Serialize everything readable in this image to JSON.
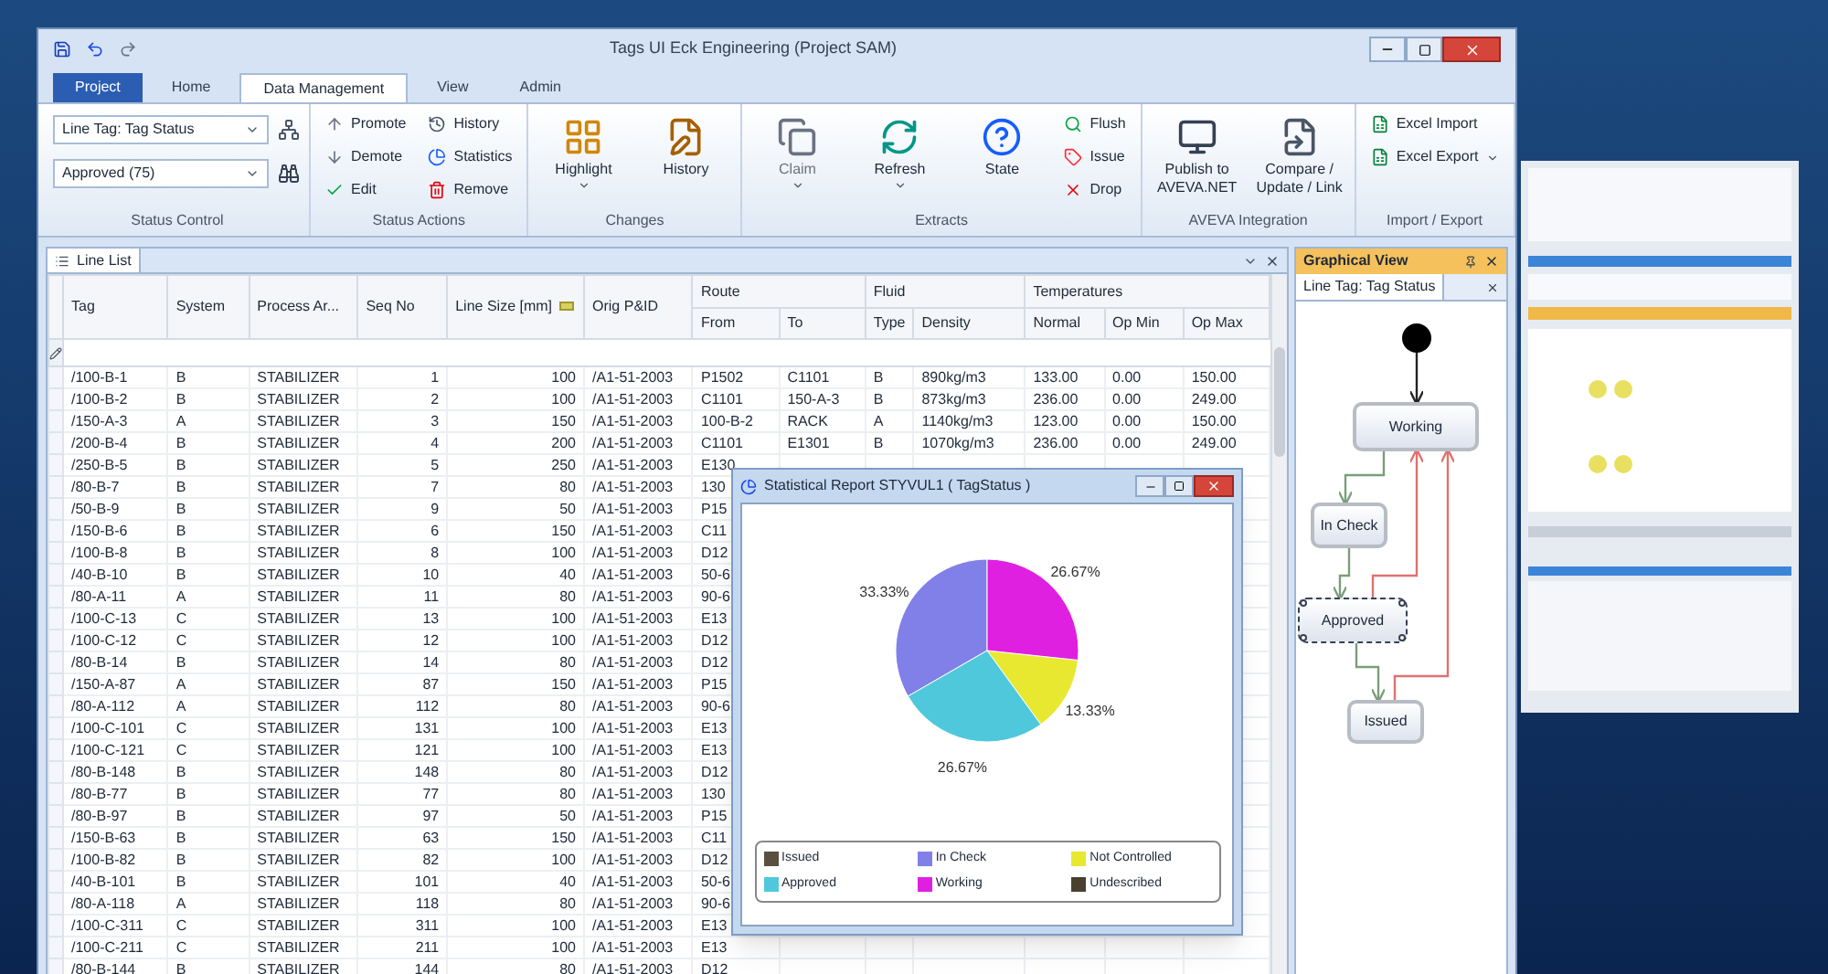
{
  "window": {
    "title": "Tags UI Eck Engineering (Project SAM)"
  },
  "ribbon_tabs": [
    {
      "label": "Project",
      "kind": "app",
      "selected": false
    },
    {
      "label": "Home",
      "kind": "tab",
      "selected": false
    },
    {
      "label": "Data Management",
      "kind": "tab",
      "selected": true
    },
    {
      "label": "View",
      "kind": "tab",
      "selected": false
    },
    {
      "label": "Admin",
      "kind": "tab",
      "selected": false
    }
  ],
  "ribbon_groups": [
    {
      "label": "Status Control",
      "items": [
        {
          "kind": "dropdown",
          "value": "Line Tag: Tag Status"
        },
        {
          "kind": "dropdown",
          "value": "Approved (75)"
        }
      ]
    },
    {
      "label": "Status Actions",
      "items": [
        {
          "kind": "small",
          "label": "Promote",
          "disabled": false,
          "menu": false
        },
        {
          "kind": "small",
          "label": "Demote",
          "disabled": false,
          "menu": false
        },
        {
          "kind": "small",
          "label": "Edit",
          "disabled": false,
          "menu": false
        },
        {
          "kind": "small",
          "label": "History",
          "disabled": false,
          "menu": false
        },
        {
          "kind": "small",
          "label": "Statistics",
          "disabled": false,
          "menu": false
        },
        {
          "kind": "small",
          "label": "Remove",
          "disabled": false,
          "menu": false
        }
      ]
    },
    {
      "label": "Changes",
      "items": [
        {
          "kind": "large",
          "label": "Highlight",
          "disabled": false,
          "menu": true
        },
        {
          "kind": "large",
          "label": "History",
          "disabled": false,
          "menu": false
        }
      ]
    },
    {
      "label": "Extracts",
      "items": [
        {
          "kind": "large",
          "label": "Claim",
          "disabled": true,
          "menu": true
        },
        {
          "kind": "large",
          "label": "Refresh",
          "disabled": false,
          "menu": true
        },
        {
          "kind": "large",
          "label": "State",
          "disabled": false,
          "menu": false
        },
        {
          "kind": "small",
          "label": "Flush",
          "disabled": false,
          "menu": false
        },
        {
          "kind": "small",
          "label": "Issue",
          "disabled": false,
          "menu": false
        },
        {
          "kind": "small",
          "label": "Drop",
          "disabled": false,
          "menu": false
        }
      ]
    },
    {
      "label": "AVEVA Integration",
      "items": [
        {
          "kind": "large",
          "label": "Publish to AVEVA.NET",
          "disabled": false,
          "menu": false
        },
        {
          "kind": "large",
          "label": "Compare / Update / Link",
          "disabled": false,
          "menu": false
        }
      ]
    },
    {
      "label": "Import / Export",
      "items": [
        {
          "kind": "small",
          "label": "Excel Import",
          "disabled": false,
          "menu": false
        },
        {
          "kind": "small",
          "label": "Excel Export",
          "disabled": false,
          "menu": true
        }
      ]
    }
  ],
  "line_list": {
    "title": "Line List",
    "column_groups": [
      {
        "label": "Route"
      },
      {
        "label": "Fluid"
      },
      {
        "label": "Temperatures"
      }
    ],
    "columns": [
      {
        "label": "Tag"
      },
      {
        "label": "System"
      },
      {
        "label": "Process Ar..."
      },
      {
        "label": "Seq No"
      },
      {
        "label": "Line Size [mm]"
      },
      {
        "label": "Orig P&ID"
      },
      {
        "label": "From"
      },
      {
        "label": "To"
      },
      {
        "label": "Type"
      },
      {
        "label": "Density"
      },
      {
        "label": "Normal"
      },
      {
        "label": "Op Min"
      },
      {
        "label": "Op Max"
      }
    ],
    "rows": [
      [
        "/100-B-1",
        "B",
        "STABILIZER",
        "1",
        "100",
        "/A1-51-2003",
        "P1502",
        "C1101",
        "B",
        "890kg/m3",
        "133.00",
        "0.00",
        "150.00"
      ],
      [
        "/100-B-2",
        "B",
        "STABILIZER",
        "2",
        "100",
        "/A1-51-2003",
        "C1101",
        "150-A-3",
        "B",
        "873kg/m3",
        "236.00",
        "0.00",
        "249.00"
      ],
      [
        "/150-A-3",
        "A",
        "STABILIZER",
        "3",
        "150",
        "/A1-51-2003",
        "100-B-2",
        "RACK",
        "A",
        "1140kg/m3",
        "123.00",
        "0.00",
        "150.00"
      ],
      [
        "/200-B-4",
        "B",
        "STABILIZER",
        "4",
        "200",
        "/A1-51-2003",
        "C1101",
        "E1301",
        "B",
        "1070kg/m3",
        "236.00",
        "0.00",
        "249.00"
      ],
      [
        "/250-B-5",
        "B",
        "STABILIZER",
        "5",
        "250",
        "/A1-51-2003",
        "E130"
      ],
      [
        "/80-B-7",
        "B",
        "STABILIZER",
        "7",
        "80",
        "/A1-51-2003",
        "130"
      ],
      [
        "/50-B-9",
        "B",
        "STABILIZER",
        "9",
        "50",
        "/A1-51-2003",
        "P15"
      ],
      [
        "/150-B-6",
        "B",
        "STABILIZER",
        "6",
        "150",
        "/A1-51-2003",
        "C11"
      ],
      [
        "/100-B-8",
        "B",
        "STABILIZER",
        "8",
        "100",
        "/A1-51-2003",
        "D12"
      ],
      [
        "/40-B-10",
        "B",
        "STABILIZER",
        "10",
        "40",
        "/A1-51-2003",
        "50-6"
      ],
      [
        "/80-A-11",
        "A",
        "STABILIZER",
        "11",
        "80",
        "/A1-51-2003",
        "90-6"
      ],
      [
        "/100-C-13",
        "C",
        "STABILIZER",
        "13",
        "100",
        "/A1-51-2003",
        "E13"
      ],
      [
        "/100-C-12",
        "C",
        "STABILIZER",
        "12",
        "100",
        "/A1-51-2003",
        "D12"
      ],
      [
        "/80-B-14",
        "B",
        "STABILIZER",
        "14",
        "80",
        "/A1-51-2003",
        "D12"
      ],
      [
        "/150-A-87",
        "A",
        "STABILIZER",
        "87",
        "150",
        "/A1-51-2003",
        "P15"
      ],
      [
        "/80-A-112",
        "A",
        "STABILIZER",
        "112",
        "80",
        "/A1-51-2003",
        "90-6"
      ],
      [
        "/100-C-101",
        "C",
        "STABILIZER",
        "131",
        "100",
        "/A1-51-2003",
        "E13"
      ],
      [
        "/100-C-121",
        "C",
        "STABILIZER",
        "121",
        "100",
        "/A1-51-2003",
        "E13"
      ],
      [
        "/80-B-148",
        "B",
        "STABILIZER",
        "148",
        "80",
        "/A1-51-2003",
        "D12"
      ],
      [
        "/80-B-77",
        "B",
        "STABILIZER",
        "77",
        "80",
        "/A1-51-2003",
        "130"
      ],
      [
        "/80-B-97",
        "B",
        "STABILIZER",
        "97",
        "50",
        "/A1-51-2003",
        "P15"
      ],
      [
        "/150-B-63",
        "B",
        "STABILIZER",
        "63",
        "150",
        "/A1-51-2003",
        "C11"
      ],
      [
        "/100-B-82",
        "B",
        "STABILIZER",
        "82",
        "100",
        "/A1-51-2003",
        "D12"
      ],
      [
        "/40-B-101",
        "B",
        "STABILIZER",
        "101",
        "40",
        "/A1-51-2003",
        "50-6"
      ],
      [
        "/80-A-118",
        "A",
        "STABILIZER",
        "118",
        "80",
        "/A1-51-2003",
        "90-6"
      ],
      [
        "/100-C-311",
        "C",
        "STABILIZER",
        "311",
        "100",
        "/A1-51-2003",
        "E13"
      ],
      [
        "/100-C-211",
        "C",
        "STABILIZER",
        "211",
        "100",
        "/A1-51-2003",
        "E13"
      ],
      [
        "/80-B-144",
        "B",
        "STABILIZER",
        "144",
        "80",
        "/A1-51-2003",
        "D12"
      ]
    ]
  },
  "report_dialog": {
    "title": "Statistical Report STYVUL1 ( TagStatus )",
    "chart_data": {
      "type": "pie",
      "categories": [
        "Issued",
        "In Check",
        "Not Controlled",
        "Approved",
        "Working",
        "Undescribed"
      ],
      "values": [
        0,
        33.33,
        13.33,
        26.67,
        26.67,
        0
      ],
      "value_labels": [
        null,
        "33.33%",
        "13.33%",
        "26.67%",
        "26.67%",
        null
      ]
    },
    "legend": [
      {
        "color": "#5a5040"
      },
      {
        "color": "#8080e8"
      },
      {
        "color": "#e8e830"
      },
      {
        "color": "#50c8dc"
      },
      {
        "color": "#e020e0"
      },
      {
        "color": "#4a4030"
      }
    ]
  },
  "graphical_view": {
    "title": "Graphical View",
    "tab": "Line Tag: Tag Status",
    "nodes": [
      {
        "label": "Working",
        "selected": false
      },
      {
        "label": "In Check",
        "selected": false
      },
      {
        "label": "Approved",
        "selected": true
      },
      {
        "label": "Issued",
        "selected": false
      }
    ]
  }
}
